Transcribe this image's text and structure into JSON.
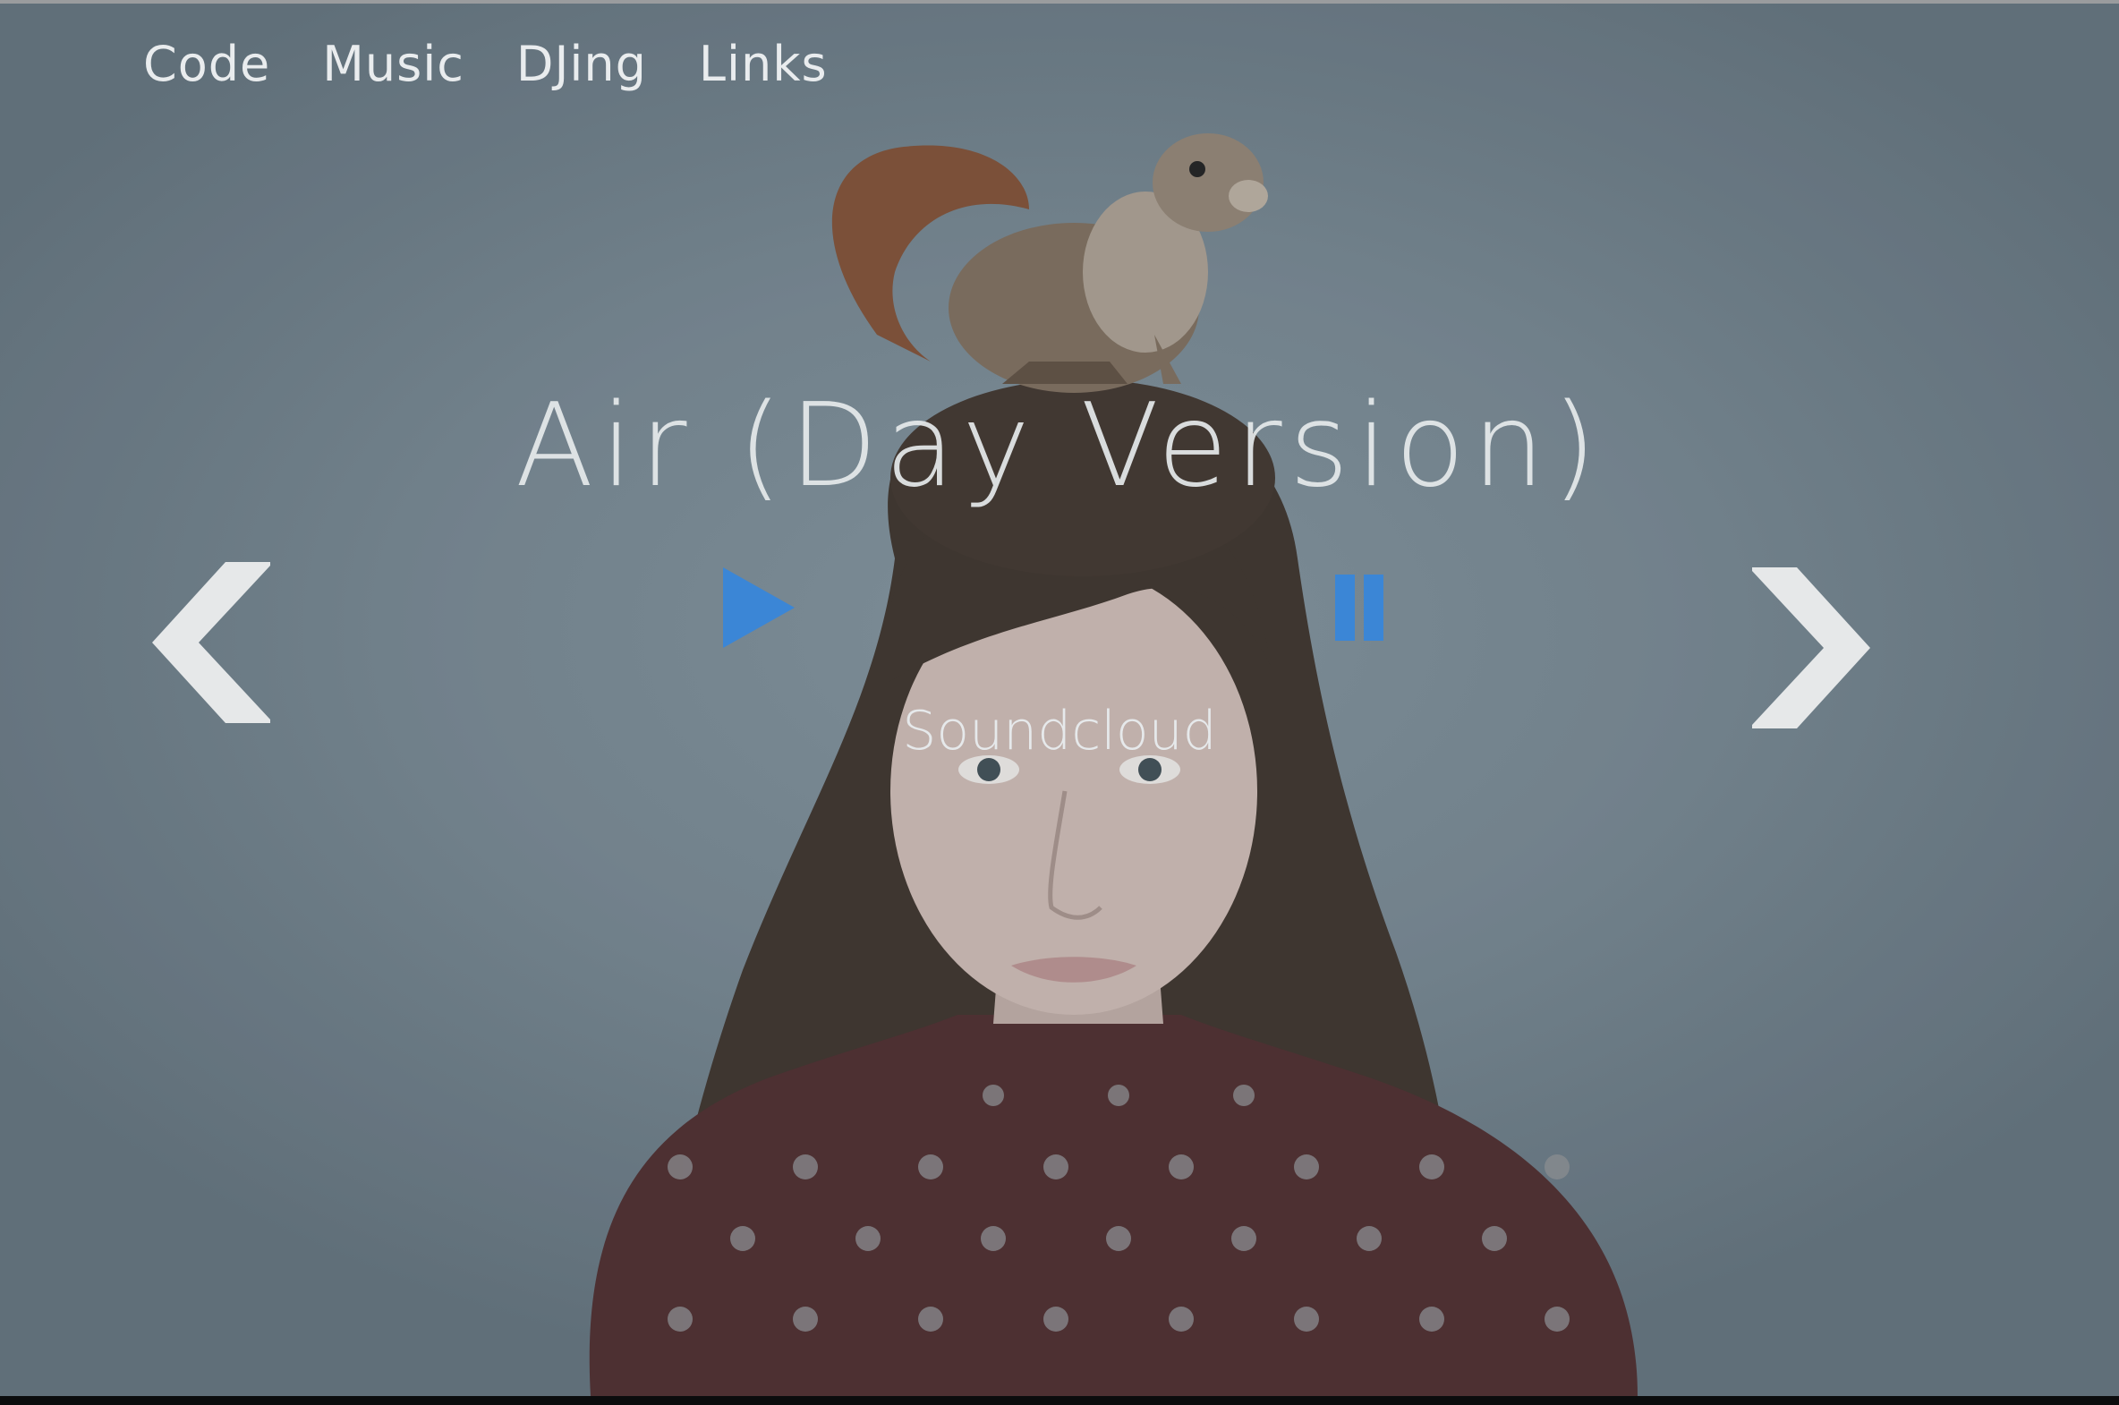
{
  "nav": {
    "items": [
      {
        "label": "Code"
      },
      {
        "label": "Music"
      },
      {
        "label": "DJing"
      },
      {
        "label": "Links"
      }
    ]
  },
  "player": {
    "track_title": "Air (Day Version)",
    "link_label": "Soundcloud"
  },
  "icons": {
    "play": "play-icon",
    "pause": "pause-icon",
    "previous": "chevron-left-icon",
    "next": "chevron-right-icon"
  },
  "colors": {
    "accent": "#3b86d6",
    "chevron": "#e6e8e9",
    "text": "#e9ecee"
  }
}
